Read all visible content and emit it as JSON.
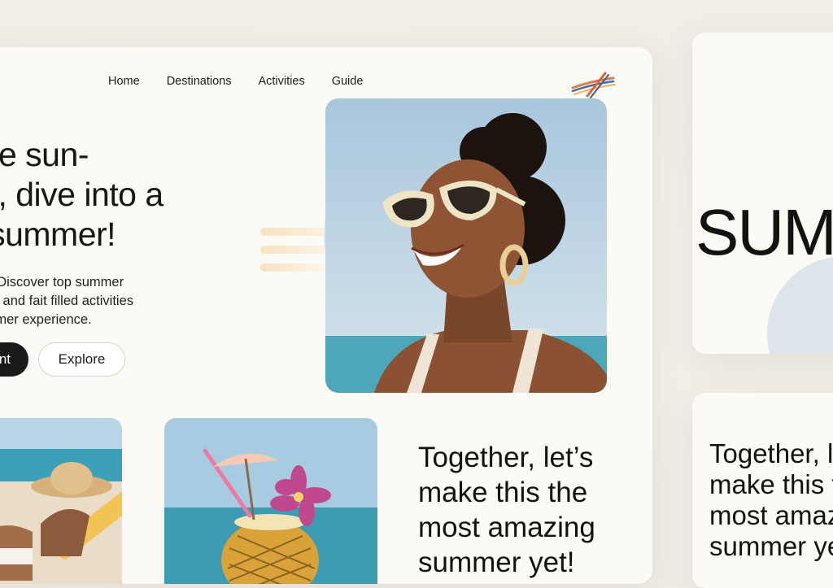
{
  "nav": {
    "items": [
      "Home",
      "Destinations",
      "Activities",
      "Guide"
    ]
  },
  "hero": {
    "title_lines": [
      "come sun-",
      "kers, dive into a",
      "ect summer!"
    ],
    "description_lines": [
      "centure: Discover top summer",
      "s friends, and fait filled activities",
      "late summer experience."
    ],
    "primary_button": "nt",
    "secondary_button": "Explore"
  },
  "tagline": {
    "lines": [
      "Together, let’s",
      "make this the",
      "most amazing",
      "summer yet!"
    ]
  },
  "side_cards": {
    "sum_text": "SUM",
    "together_lines": [
      "Together, l",
      "make this t",
      "most amaz",
      "summer ye"
    ]
  },
  "icons": {
    "logo": "sunglasses-stripes-logo",
    "hero_image": "woman-sunglasses-photo",
    "beach_image": "beach-lounger-photo",
    "drink_image": "pineapple-cocktail-photo"
  },
  "colors": {
    "background": "#f1ede7",
    "card": "#fcfaf5",
    "button_dark": "#1a1a1a",
    "sky": "#b9d2e2",
    "sea": "#3f9fb4"
  }
}
